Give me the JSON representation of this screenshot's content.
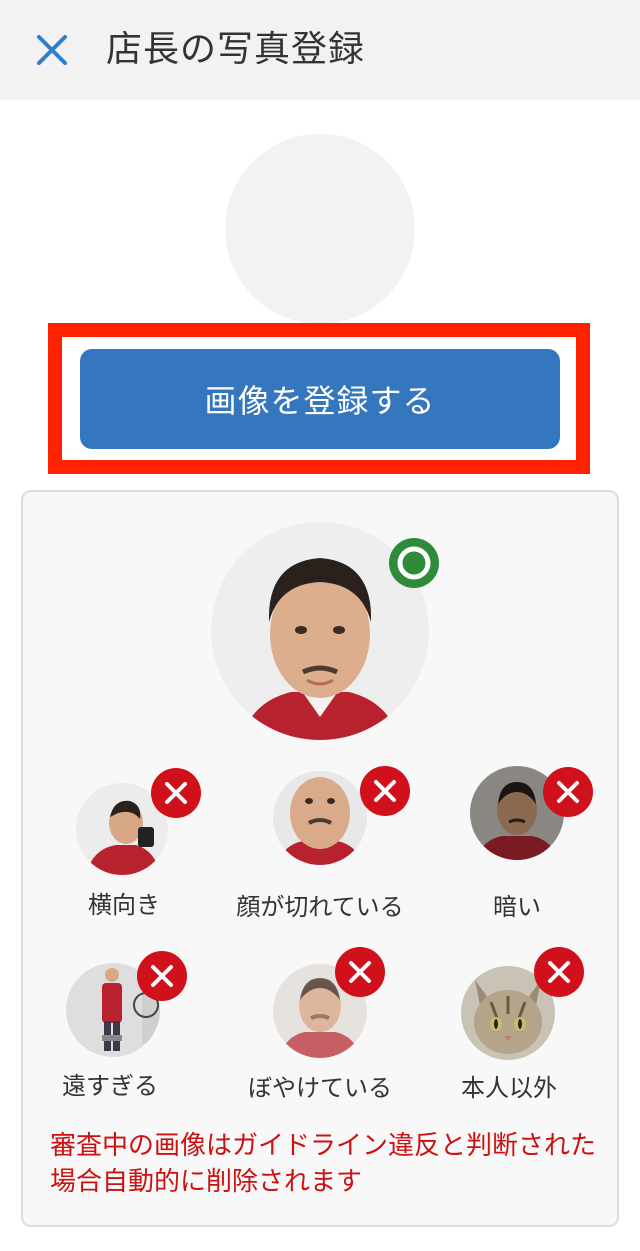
{
  "header": {
    "title": "店長の写真登録",
    "close_icon": "close-icon"
  },
  "main": {
    "register_button_label": "画像を登録する"
  },
  "guide": {
    "good_example": {
      "status_icon": "ok-circle-icon",
      "status_color": "#2e8b3a"
    },
    "bad_examples": [
      {
        "label": "横向き",
        "status_icon": "x-circle-icon"
      },
      {
        "label": "顔が切れている",
        "status_icon": "x-circle-icon"
      },
      {
        "label": "暗い",
        "status_icon": "x-circle-icon"
      },
      {
        "label": "遠すぎる",
        "status_icon": "x-circle-icon"
      },
      {
        "label": "ぼやけている",
        "status_icon": "x-circle-icon"
      },
      {
        "label": "本人以外",
        "status_icon": "x-circle-icon"
      }
    ],
    "ng_color": "#d0101a",
    "warning_text": "審査中の画像はガイドライン違反と判断された場合自動的に削除されます"
  },
  "colors": {
    "accent_blue": "#3477be",
    "highlight_red": "#ff2200",
    "warning_red": "#cc1111"
  }
}
